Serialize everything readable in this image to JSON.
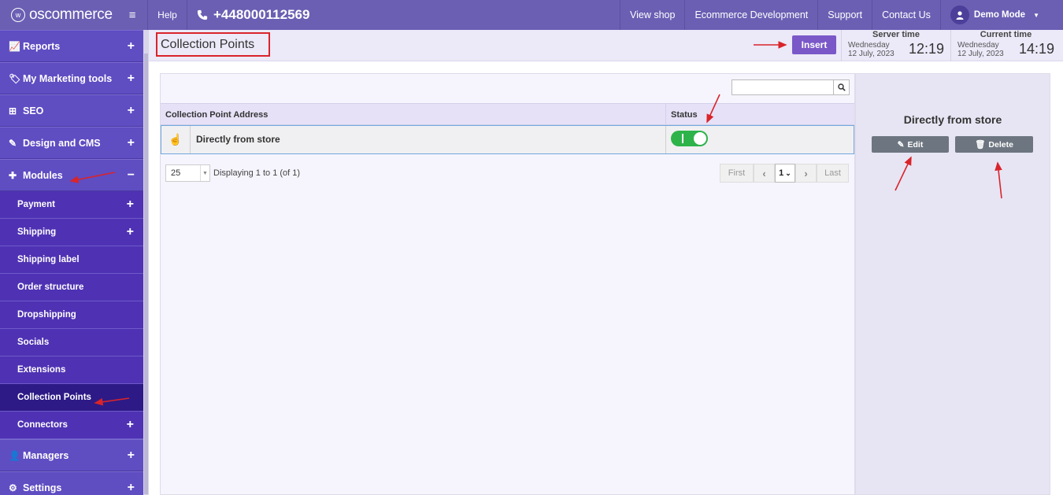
{
  "header": {
    "logo_text": "oscommerce",
    "help_label": "Help",
    "phone": "+448000112569",
    "links": [
      "View shop",
      "Ecommerce Development",
      "Support",
      "Contact Us"
    ],
    "user_label": "Demo Mode"
  },
  "sidebar": {
    "main_items": [
      {
        "label": "Reports",
        "icon": "chart-line-icon",
        "sign": "+"
      },
      {
        "label": "My Marketing tools",
        "icon": "tag-icon",
        "sign": "+"
      },
      {
        "label": "SEO",
        "icon": "sitemap-icon",
        "sign": "+"
      },
      {
        "label": "Design and CMS",
        "icon": "brush-icon",
        "sign": "+"
      },
      {
        "label": "Modules",
        "icon": "puzzle-icon",
        "sign": "−"
      }
    ],
    "sub_items": [
      {
        "label": "Payment",
        "sign": "+"
      },
      {
        "label": "Shipping",
        "sign": "+"
      },
      {
        "label": "Shipping label",
        "sign": ""
      },
      {
        "label": "Order structure",
        "sign": ""
      },
      {
        "label": "Dropshipping",
        "sign": ""
      },
      {
        "label": "Socials",
        "sign": ""
      },
      {
        "label": "Extensions",
        "sign": ""
      },
      {
        "label": "Collection Points",
        "sign": ""
      },
      {
        "label": "Connectors",
        "sign": "+"
      }
    ],
    "bottom_items": [
      {
        "label": "Managers",
        "icon": "user-icon",
        "sign": "+"
      },
      {
        "label": "Settings",
        "icon": "gears-icon",
        "sign": "+"
      }
    ]
  },
  "page": {
    "title": "Collection Points",
    "insert_label": "Insert",
    "server_time": {
      "title": "Server time",
      "day": "Wednesday",
      "date": "12 July, 2023",
      "time": "12:19"
    },
    "current_time": {
      "title": "Current time",
      "day": "Wednesday",
      "date": "12 July, 2023",
      "time": "14:19"
    }
  },
  "table": {
    "search_value": "",
    "columns": [
      "Collection Point Address",
      "Status"
    ],
    "rows": [
      {
        "address": "Directly from store",
        "status": "on"
      }
    ],
    "per_page": "25",
    "displaying": "Displaying 1 to 1 (of 1)",
    "pager": {
      "first": "First",
      "page": "1",
      "last": "Last"
    }
  },
  "side_panel": {
    "title": "Directly from store",
    "edit_label": "Edit",
    "delete_label": "Delete"
  },
  "colors": {
    "topbar": "#6a5fb3",
    "sidebar": "#5a45bf",
    "active_item": "#2d1a86",
    "toggle_on": "#2db34a",
    "annotation": "#d9242a"
  }
}
